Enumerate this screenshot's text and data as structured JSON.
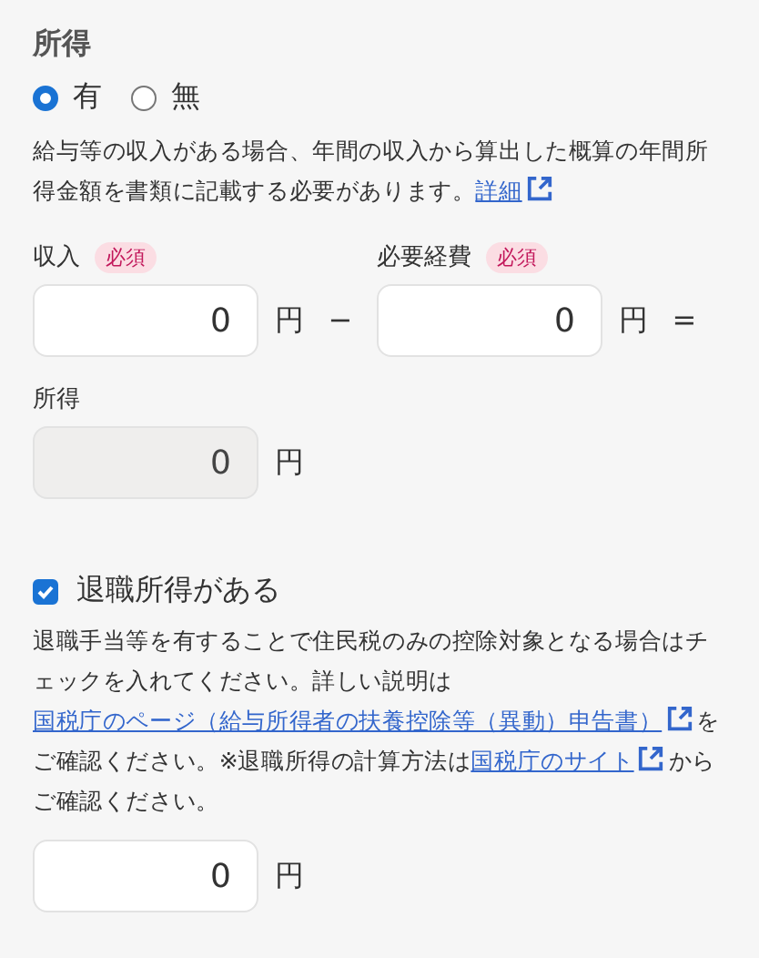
{
  "section": {
    "title": "所得"
  },
  "radios": [
    {
      "label": "有",
      "selected": true
    },
    {
      "label": "無",
      "selected": false
    }
  ],
  "description": [
    {
      "kind": "text",
      "text": "給与等の収入がある場合、年間の収入から算出した概算の年間所得金額を書類に記載する必要があります。"
    },
    {
      "kind": "link",
      "text": "詳細"
    }
  ],
  "fields": [
    {
      "label": "収入",
      "badge": "必須",
      "value": "0",
      "unit": "円",
      "operator": "−",
      "disabled": false
    },
    {
      "label": "必要経費",
      "badge": "必須",
      "value": "0",
      "unit": "円",
      "operator": "=",
      "disabled": false
    }
  ],
  "result": {
    "label": "所得",
    "value": "0",
    "unit": "円",
    "disabled": true
  },
  "retirement": {
    "label": "退職所得がある",
    "checked": true,
    "description": [
      {
        "kind": "text",
        "text": "退職手当等を有することで住民税のみの控除対象となる場合はチェックを入れてください。詳しい説明は"
      },
      {
        "kind": "link",
        "text": "国税庁のページ（給与所得者の扶養控除等（異動）申告書）"
      },
      {
        "kind": "text",
        "text": "をご確認ください。※退職所得の計算方法は"
      },
      {
        "kind": "link",
        "text": "国税庁のサイト"
      },
      {
        "kind": "text",
        "text": "からご確認ください。"
      }
    ],
    "value": "0",
    "unit": "円",
    "disabled": false
  }
}
